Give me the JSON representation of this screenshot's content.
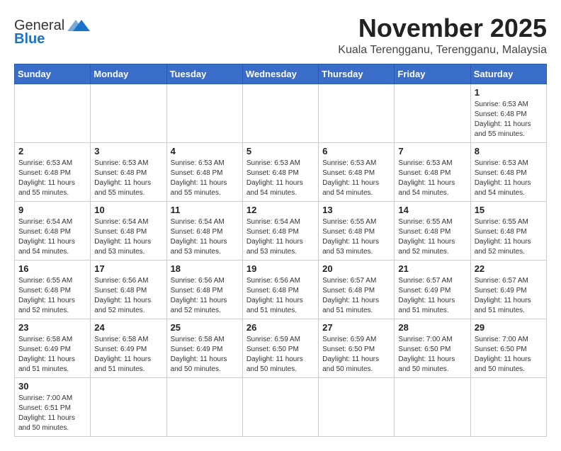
{
  "header": {
    "logo_line1": "General",
    "logo_line2": "Blue",
    "month_title": "November 2025",
    "location": "Kuala Terengganu, Terengganu, Malaysia"
  },
  "days_of_week": [
    "Sunday",
    "Monday",
    "Tuesday",
    "Wednesday",
    "Thursday",
    "Friday",
    "Saturday"
  ],
  "weeks": [
    [
      {
        "day": "",
        "info": ""
      },
      {
        "day": "",
        "info": ""
      },
      {
        "day": "",
        "info": ""
      },
      {
        "day": "",
        "info": ""
      },
      {
        "day": "",
        "info": ""
      },
      {
        "day": "",
        "info": ""
      },
      {
        "day": "1",
        "info": "Sunrise: 6:53 AM\nSunset: 6:48 PM\nDaylight: 11 hours\nand 55 minutes."
      }
    ],
    [
      {
        "day": "2",
        "info": "Sunrise: 6:53 AM\nSunset: 6:48 PM\nDaylight: 11 hours\nand 55 minutes."
      },
      {
        "day": "3",
        "info": "Sunrise: 6:53 AM\nSunset: 6:48 PM\nDaylight: 11 hours\nand 55 minutes."
      },
      {
        "day": "4",
        "info": "Sunrise: 6:53 AM\nSunset: 6:48 PM\nDaylight: 11 hours\nand 55 minutes."
      },
      {
        "day": "5",
        "info": "Sunrise: 6:53 AM\nSunset: 6:48 PM\nDaylight: 11 hours\nand 54 minutes."
      },
      {
        "day": "6",
        "info": "Sunrise: 6:53 AM\nSunset: 6:48 PM\nDaylight: 11 hours\nand 54 minutes."
      },
      {
        "day": "7",
        "info": "Sunrise: 6:53 AM\nSunset: 6:48 PM\nDaylight: 11 hours\nand 54 minutes."
      },
      {
        "day": "8",
        "info": "Sunrise: 6:53 AM\nSunset: 6:48 PM\nDaylight: 11 hours\nand 54 minutes."
      }
    ],
    [
      {
        "day": "9",
        "info": "Sunrise: 6:54 AM\nSunset: 6:48 PM\nDaylight: 11 hours\nand 54 minutes."
      },
      {
        "day": "10",
        "info": "Sunrise: 6:54 AM\nSunset: 6:48 PM\nDaylight: 11 hours\nand 53 minutes."
      },
      {
        "day": "11",
        "info": "Sunrise: 6:54 AM\nSunset: 6:48 PM\nDaylight: 11 hours\nand 53 minutes."
      },
      {
        "day": "12",
        "info": "Sunrise: 6:54 AM\nSunset: 6:48 PM\nDaylight: 11 hours\nand 53 minutes."
      },
      {
        "day": "13",
        "info": "Sunrise: 6:55 AM\nSunset: 6:48 PM\nDaylight: 11 hours\nand 53 minutes."
      },
      {
        "day": "14",
        "info": "Sunrise: 6:55 AM\nSunset: 6:48 PM\nDaylight: 11 hours\nand 52 minutes."
      },
      {
        "day": "15",
        "info": "Sunrise: 6:55 AM\nSunset: 6:48 PM\nDaylight: 11 hours\nand 52 minutes."
      }
    ],
    [
      {
        "day": "16",
        "info": "Sunrise: 6:55 AM\nSunset: 6:48 PM\nDaylight: 11 hours\nand 52 minutes."
      },
      {
        "day": "17",
        "info": "Sunrise: 6:56 AM\nSunset: 6:48 PM\nDaylight: 11 hours\nand 52 minutes."
      },
      {
        "day": "18",
        "info": "Sunrise: 6:56 AM\nSunset: 6:48 PM\nDaylight: 11 hours\nand 52 minutes."
      },
      {
        "day": "19",
        "info": "Sunrise: 6:56 AM\nSunset: 6:48 PM\nDaylight: 11 hours\nand 51 minutes."
      },
      {
        "day": "20",
        "info": "Sunrise: 6:57 AM\nSunset: 6:48 PM\nDaylight: 11 hours\nand 51 minutes."
      },
      {
        "day": "21",
        "info": "Sunrise: 6:57 AM\nSunset: 6:49 PM\nDaylight: 11 hours\nand 51 minutes."
      },
      {
        "day": "22",
        "info": "Sunrise: 6:57 AM\nSunset: 6:49 PM\nDaylight: 11 hours\nand 51 minutes."
      }
    ],
    [
      {
        "day": "23",
        "info": "Sunrise: 6:58 AM\nSunset: 6:49 PM\nDaylight: 11 hours\nand 51 minutes."
      },
      {
        "day": "24",
        "info": "Sunrise: 6:58 AM\nSunset: 6:49 PM\nDaylight: 11 hours\nand 51 minutes."
      },
      {
        "day": "25",
        "info": "Sunrise: 6:58 AM\nSunset: 6:49 PM\nDaylight: 11 hours\nand 50 minutes."
      },
      {
        "day": "26",
        "info": "Sunrise: 6:59 AM\nSunset: 6:50 PM\nDaylight: 11 hours\nand 50 minutes."
      },
      {
        "day": "27",
        "info": "Sunrise: 6:59 AM\nSunset: 6:50 PM\nDaylight: 11 hours\nand 50 minutes."
      },
      {
        "day": "28",
        "info": "Sunrise: 7:00 AM\nSunset: 6:50 PM\nDaylight: 11 hours\nand 50 minutes."
      },
      {
        "day": "29",
        "info": "Sunrise: 7:00 AM\nSunset: 6:50 PM\nDaylight: 11 hours\nand 50 minutes."
      }
    ],
    [
      {
        "day": "30",
        "info": "Sunrise: 7:00 AM\nSunset: 6:51 PM\nDaylight: 11 hours\nand 50 minutes."
      },
      {
        "day": "",
        "info": ""
      },
      {
        "day": "",
        "info": ""
      },
      {
        "day": "",
        "info": ""
      },
      {
        "day": "",
        "info": ""
      },
      {
        "day": "",
        "info": ""
      },
      {
        "day": "",
        "info": ""
      }
    ]
  ]
}
